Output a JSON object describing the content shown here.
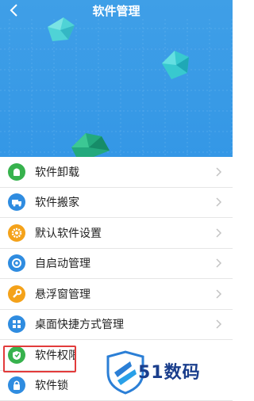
{
  "header": {
    "title": "软件管理",
    "background": "#3a9be6"
  },
  "menu": {
    "items": [
      {
        "label": "软件卸载",
        "icon": "android-uninstall-icon",
        "color": "#37b24d"
      },
      {
        "label": "软件搬家",
        "icon": "truck-move-icon",
        "color": "#2f8ce0"
      },
      {
        "label": "默认软件设置",
        "icon": "gear-icon",
        "color": "#f4a21a"
      },
      {
        "label": "自启动管理",
        "icon": "power-icon",
        "color": "#2f8ce0"
      },
      {
        "label": "悬浮窗管理",
        "icon": "wrench-icon",
        "color": "#f4a21a"
      },
      {
        "label": "桌面快捷方式管理",
        "icon": "grid-shortcut-icon",
        "color": "#2f8ce0"
      },
      {
        "label": "软件权限管理",
        "icon": "shield-permission-icon",
        "color": "#37b24d"
      },
      {
        "label": "软件锁",
        "icon": "lock-icon",
        "color": "#2f8ce0"
      }
    ]
  },
  "watermark": {
    "text": "51数码"
  }
}
